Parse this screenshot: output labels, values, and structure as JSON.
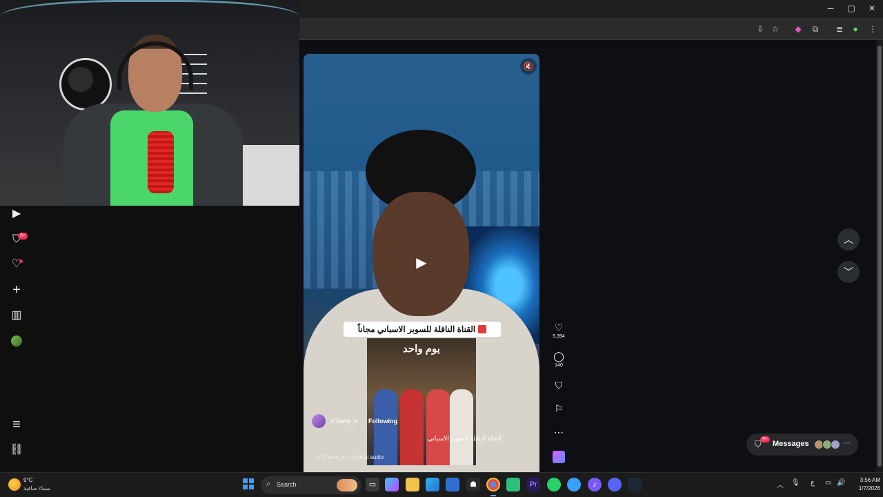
{
  "browser": {
    "window_controls": {
      "minimize": "─",
      "maximize": "▢",
      "close": "✕"
    },
    "toolbar_icons": [
      "install-icon",
      "star-icon",
      "extension-badge-icon",
      "puzzle-icon",
      "media-icon",
      "profile-icon",
      "menu-icon"
    ]
  },
  "left_nav": {
    "items": [
      {
        "name": "live",
        "glyph": "▶"
      },
      {
        "name": "inbox",
        "glyph": "⛉",
        "badge": "9+"
      },
      {
        "name": "activity",
        "glyph": "♡",
        "dot": true
      },
      {
        "name": "upload",
        "glyph": "+"
      },
      {
        "name": "analytics",
        "glyph": "▥"
      },
      {
        "name": "profile",
        "glyph": ""
      },
      {
        "name": "more",
        "glyph": "≡"
      },
      {
        "name": "settings",
        "glyph": "⛓"
      }
    ]
  },
  "video": {
    "caption_ar": "القناة الناقلة للسوبر الاسباني مجاناً",
    "poster_title": "يوم واحد",
    "author": "ir7eem_o",
    "follow_label": "Following",
    "description_ar": "القناة الناقلة للسوبر الاسباني",
    "audio_label": "♫ ir7eem_o · Original audio"
  },
  "actions": {
    "like_count": "5,394",
    "comment_count": "140"
  },
  "messages": {
    "label": "Messages",
    "badge": "9+"
  },
  "taskbar": {
    "weather_temp": "9°C",
    "weather_desc": "سماء صافية",
    "search_label": "Search",
    "tray_lang": "ع",
    "time": "3:56 AM",
    "date": "1/7/2026"
  },
  "colors": {
    "tiktok_red": "#fe2c55",
    "page_bg": "#0d0f12",
    "taskbar_bg": "#1c1c1c"
  }
}
